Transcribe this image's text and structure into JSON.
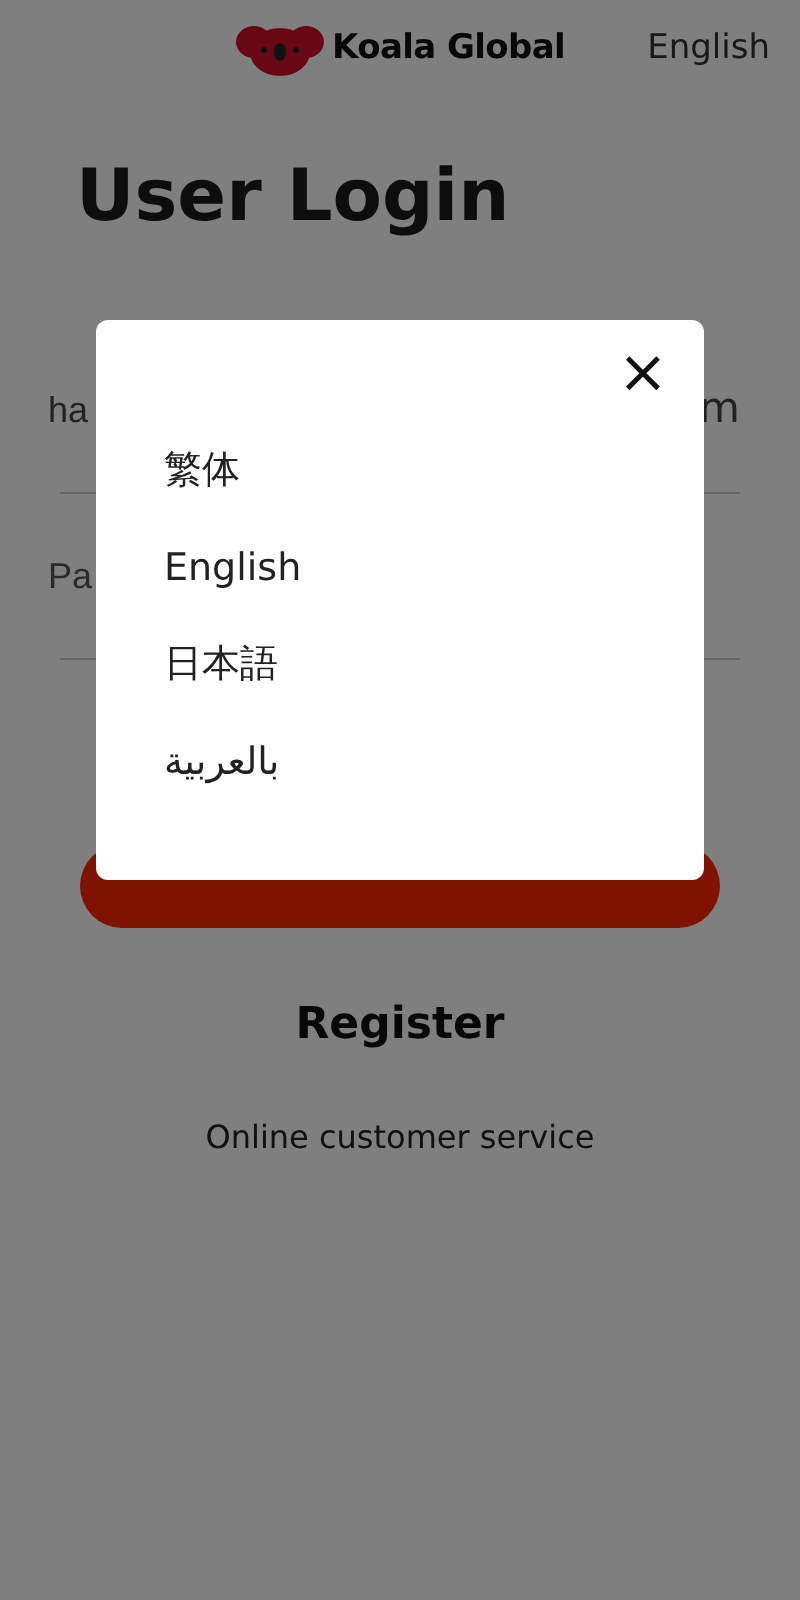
{
  "header": {
    "brand": "Koala Global",
    "language": "English"
  },
  "title": "User Login",
  "username_field": {
    "visible_start": "ha",
    "visible_end": "m"
  },
  "password_field": {
    "placeholder": "Pa"
  },
  "register": "Register",
  "customer_service": "Online customer service",
  "language_dialog": {
    "close": "×",
    "options": [
      {
        "label": "繁体"
      },
      {
        "label": "English"
      },
      {
        "label": "日本語"
      },
      {
        "label": "بالعربية"
      }
    ]
  }
}
